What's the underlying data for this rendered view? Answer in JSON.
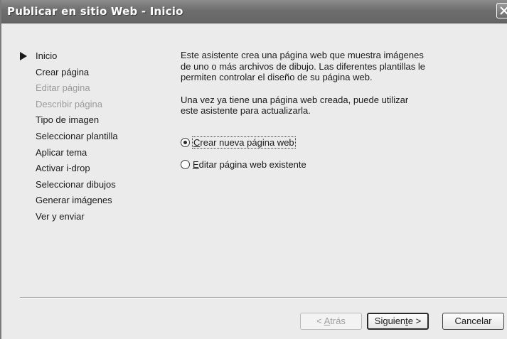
{
  "window": {
    "title": "Publicar en sitio Web - Inicio"
  },
  "steps": [
    {
      "label": "Inicio",
      "state": "current"
    },
    {
      "label": "Crear página",
      "state": "enabled"
    },
    {
      "label": "Editar página",
      "state": "disabled"
    },
    {
      "label": "Describir página",
      "state": "disabled"
    },
    {
      "label": "Tipo de imagen",
      "state": "enabled"
    },
    {
      "label": "Seleccionar plantilla",
      "state": "enabled"
    },
    {
      "label": "Aplicar tema",
      "state": "enabled"
    },
    {
      "label": "Activar i-drop",
      "state": "enabled"
    },
    {
      "label": "Seleccionar dibujos",
      "state": "enabled"
    },
    {
      "label": "Generar imágenes",
      "state": "enabled"
    },
    {
      "label": "Ver y enviar",
      "state": "enabled"
    }
  ],
  "content": {
    "intro": "Este asistente crea una página web que muestra imágenes\nde uno o más archivos de dibujo.  Las diferentes plantillas le\npermiten controlar el diseño de su página web.",
    "update_note": "Una vez ya tiene una página web creada, puede utilizar\neste asistente para actualizarla."
  },
  "options": {
    "create": {
      "mnemonic": "C",
      "rest": "rear nueva página web",
      "selected": true
    },
    "edit": {
      "mnemonic": "E",
      "rest": "ditar página web existente",
      "selected": false
    }
  },
  "buttons": {
    "back": {
      "prefix": "< ",
      "mnemonic": "A",
      "rest": "trás"
    },
    "next": {
      "prefix": "Siguien",
      "mnemonic": "t",
      "rest": "e >"
    },
    "cancel": {
      "label": "Cancelar"
    }
  },
  "icons": {
    "current_step": "arrow-right-icon",
    "close": "close-icon"
  },
  "colors": {
    "titlebar": "#6e6e6e",
    "face": "#ebebeb",
    "disabled_text": "#9a9a9a"
  }
}
